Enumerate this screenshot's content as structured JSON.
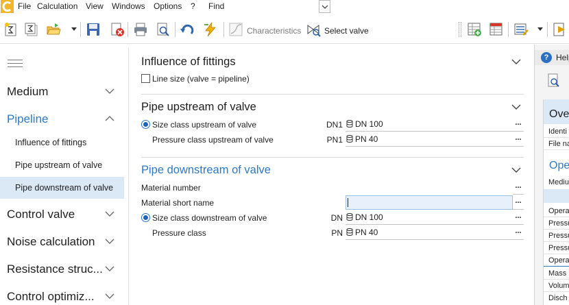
{
  "menu": {
    "items": [
      "File",
      "Calculation",
      "View",
      "Windows",
      "Options",
      "?",
      "Find"
    ]
  },
  "toolbar": {
    "characteristics_label": "Characteristics",
    "select_valve_label": "Select valve"
  },
  "sidebar": {
    "items": [
      {
        "label": "Medium",
        "expanded": false
      },
      {
        "label": "Pipeline",
        "expanded": true,
        "active": true
      },
      {
        "label": "Control valve",
        "expanded": false
      },
      {
        "label": "Noise calculation",
        "expanded": false
      },
      {
        "label": "Resistance struc...",
        "expanded": false
      },
      {
        "label": "Control optimiz...",
        "expanded": false
      }
    ],
    "subitems": [
      {
        "label": "Influence of fittings"
      },
      {
        "label": "Pipe upstream of valve"
      },
      {
        "label": "Pipe downstream of valve",
        "selected": true
      }
    ]
  },
  "main": {
    "fittings": {
      "title": "Influence of fittings",
      "line_size_label": "Line size (valve = pipeline)",
      "line_size_checked": false
    },
    "upstream": {
      "title": "Pipe upstream of valve",
      "size_label": "Size class upstream of valve",
      "size_prefix": "DN1",
      "size_value": "DN 100",
      "pressure_label": "Pressure class upstream of valve",
      "pressure_prefix": "PN1",
      "pressure_value": "PN 40"
    },
    "downstream": {
      "title": "Pipe downstream of valve",
      "material_number_label": "Material number",
      "material_short_label": "Material short name",
      "size_label": "Size class downstream of valve",
      "size_prefix": "DN",
      "size_value": "DN 100",
      "pressure_label": "Pressure class",
      "pressure_prefix": "PN",
      "pressure_value": "PN 40"
    },
    "ellipsis": "..."
  },
  "help": {
    "title": "Help",
    "section1": "Ove",
    "rows1": [
      "Identi",
      "File na"
    ],
    "section2": "Ope",
    "rows2": [
      "Mediu"
    ],
    "rows3": [
      "Opera",
      "Pressu",
      "Pressu",
      "Pressu",
      "Opera",
      "Mass",
      "Volum",
      "Disch"
    ]
  },
  "colors": {
    "accent": "#2d7ac4",
    "selection": "#dbe9f7"
  }
}
